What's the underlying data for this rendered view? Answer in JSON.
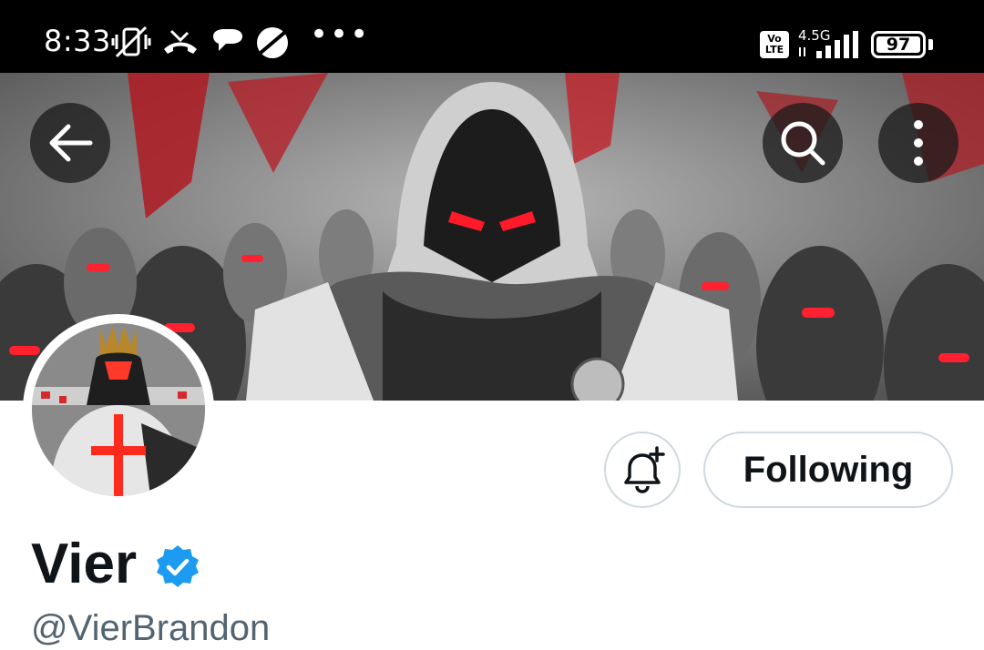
{
  "status_bar": {
    "time": "8:33",
    "more": "•••",
    "volte": "Vo LTE",
    "network_type": "4.5G",
    "battery_level": "97",
    "icons": [
      "mute-vibrate-icon",
      "missed-call-icon",
      "message-icon",
      "browser-icon",
      "signal-icon",
      "battery-icon"
    ]
  },
  "header": {
    "back_icon": "arrow-left-icon",
    "search_icon": "search-icon",
    "more_icon": "more-vertical-icon"
  },
  "profile": {
    "display_name": "Vier",
    "handle": "@VierBrandon",
    "verified": true,
    "verified_color": "#1d9bf0",
    "notify_icon": "bell-plus-icon",
    "following_label": "Following"
  },
  "colors": {
    "status_bar_bg": "#000000",
    "text_primary": "#0f1419",
    "text_secondary": "#536471",
    "border": "#cfd9de",
    "banner_accent": "#e11d2a"
  }
}
